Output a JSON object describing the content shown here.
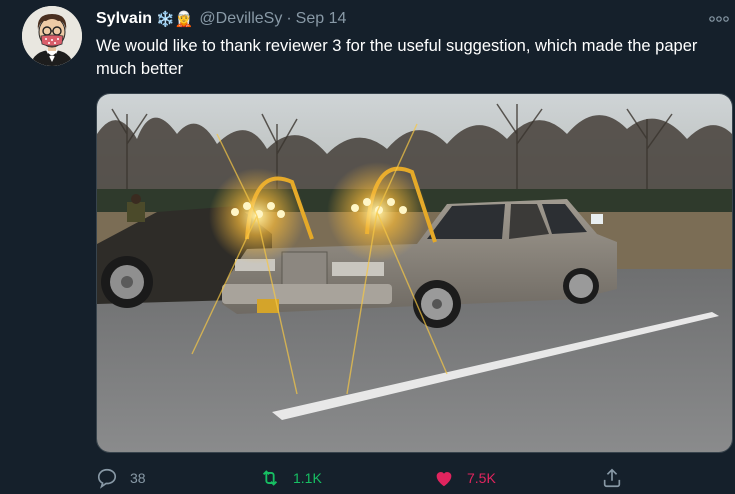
{
  "tweet": {
    "author_name": "Sylvain",
    "author_emojis": "❄️🧝",
    "handle": "@DevilleSy",
    "separator": "·",
    "date": "Sep 14",
    "text": "We would like to thank reviewer 3 for the useful suggestion, which made the paper much better",
    "more_icon": "more-dots-icon"
  },
  "media": {
    "description_icon": "car-with-chandeliers-photo"
  },
  "actions": {
    "reply_count": "38",
    "retweet_count": "1.1K",
    "like_count": "7.5K",
    "retweet_color": "#17bf63",
    "like_color": "#e0245e",
    "muted_color": "#8899a6"
  },
  "colors": {
    "background": "#15202b",
    "border": "#38444d"
  }
}
